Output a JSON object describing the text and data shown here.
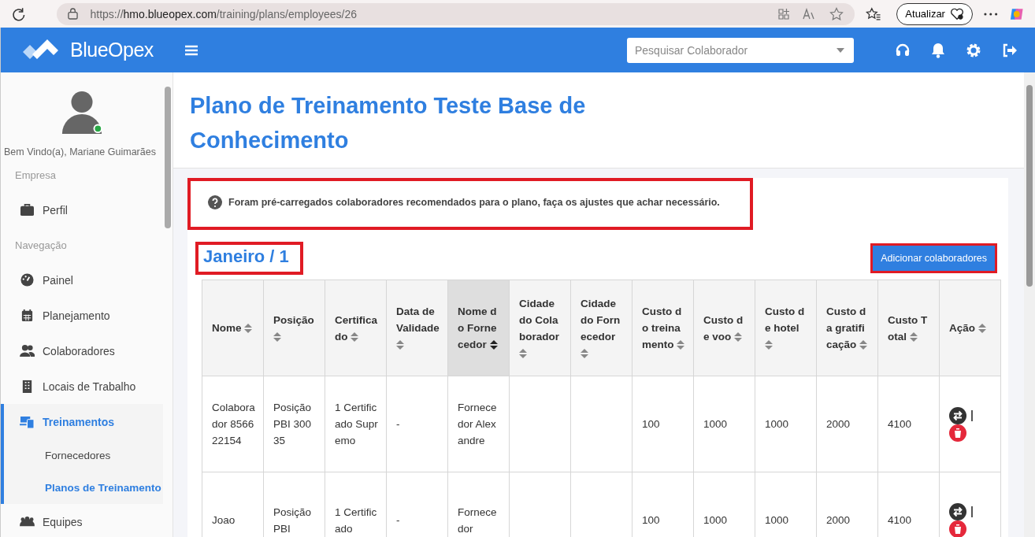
{
  "browser": {
    "url_scheme": "https://",
    "url_host": "hmo.blueopex.com",
    "url_path": "/training/plans/employees/26",
    "update_button": "Atualizar"
  },
  "header": {
    "brand": "BlueOpex",
    "search": {
      "placeholder": "Pesquisar Colaborador"
    }
  },
  "sidebar": {
    "welcome": "Bem Vindo(a), Mariane Guimarães",
    "online": true,
    "sections": [
      {
        "title": "Empresa",
        "items": [
          {
            "label": "Perfil",
            "kind": "briefcase",
            "selected": false
          }
        ]
      },
      {
        "title": "Navegação",
        "items": [
          {
            "label": "Painel",
            "kind": "gauge",
            "selected": false
          },
          {
            "label": "Planejamento",
            "kind": "calendar",
            "selected": false
          },
          {
            "label": "Colaboradores",
            "kind": "users",
            "selected": false
          },
          {
            "label": "Locais de Trabalho",
            "kind": "building",
            "selected": false
          },
          {
            "label": "Treinamentos",
            "kind": "devices",
            "selected": true,
            "children": [
              {
                "label": "Fornecedores",
                "selected": false
              },
              {
                "label": "Planos de Treinamento",
                "selected": true
              }
            ]
          },
          {
            "label": "Equipes",
            "kind": "team",
            "selected": false
          }
        ]
      }
    ]
  },
  "page": {
    "title": "Plano de Treinamento Teste Base de Conhecimento"
  },
  "notice": {
    "text": "Foram pré-carregados colaboradores recomendados para o plano, faça os ajustes que achar necessário.",
    "highlighted": true
  },
  "period": {
    "title": "Janeiro / 1",
    "highlighted": true
  },
  "add_button": {
    "label": "Adicionar colaboradores",
    "highlighted": true
  },
  "table": {
    "columns": [
      {
        "label": "Nome",
        "sorted": false
      },
      {
        "label": "Posição",
        "sorted": false
      },
      {
        "label": "Certificado",
        "sorted": false
      },
      {
        "label": "Data de Validade",
        "sorted": false
      },
      {
        "label": "Nome do Fornecedor",
        "sorted": true
      },
      {
        "label": "Cidade do Colaborador",
        "sorted": false
      },
      {
        "label": "Cidade do Fornecedor",
        "sorted": false
      },
      {
        "label": "Custo do treinamento",
        "sorted": false
      },
      {
        "label": "Custo de voo",
        "sorted": false
      },
      {
        "label": "Custo de hotel",
        "sorted": false
      },
      {
        "label": "Custo da gratificação",
        "sorted": false
      },
      {
        "label": "Custo Total",
        "sorted": false
      },
      {
        "label": "Ação",
        "sorted": false
      }
    ],
    "rows": [
      {
        "cells": [
          "Colaborador 856622154",
          "Posição PBI 30035",
          "1 Certificado Supremo",
          "-",
          "Fornecedor Alexandre",
          "",
          "",
          "100",
          "1000",
          "1000",
          "2000",
          "4100"
        ]
      },
      {
        "cells": [
          "Joao",
          "Posição PBI",
          "1 Certificado",
          "-",
          "Fornecedor",
          "",
          "",
          "100",
          "1000",
          "1000",
          "2000",
          "4100"
        ]
      }
    ]
  }
}
